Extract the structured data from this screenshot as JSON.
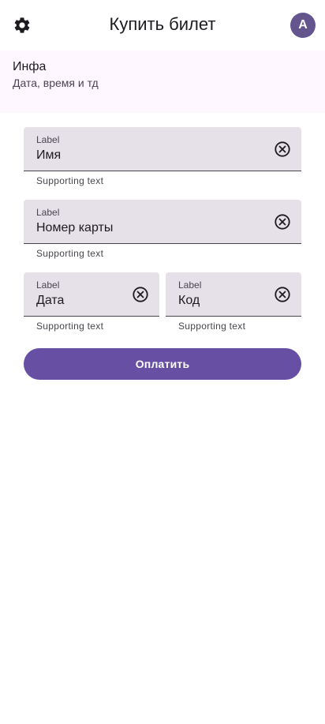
{
  "app_bar": {
    "title": "Купить билет",
    "settings_icon": "gear-icon",
    "avatar_letter": "A",
    "avatar_color": "#65558f"
  },
  "info": {
    "headline": "Инфа",
    "subtitle": "Дата, время и тд"
  },
  "form": {
    "name": {
      "label": "Label",
      "value": "Имя",
      "supporting": "Supporting text",
      "clear_icon": "cancel-circle-icon"
    },
    "card": {
      "label": "Label",
      "value": "Номер карты",
      "supporting": "Supporting text",
      "clear_icon": "cancel-circle-icon"
    },
    "date": {
      "label": "Label",
      "value": "Дата",
      "supporting": "Supporting text",
      "clear_icon": "cancel-circle-icon"
    },
    "code": {
      "label": "Label",
      "value": "Код",
      "supporting": "Supporting text",
      "clear_icon": "cancel-circle-icon"
    }
  },
  "pay_button": {
    "label": "Оплатить",
    "color": "#6750a4"
  },
  "colors": {
    "field_fill": "#e6e0e9",
    "banner_bg": "#fef7ff"
  }
}
